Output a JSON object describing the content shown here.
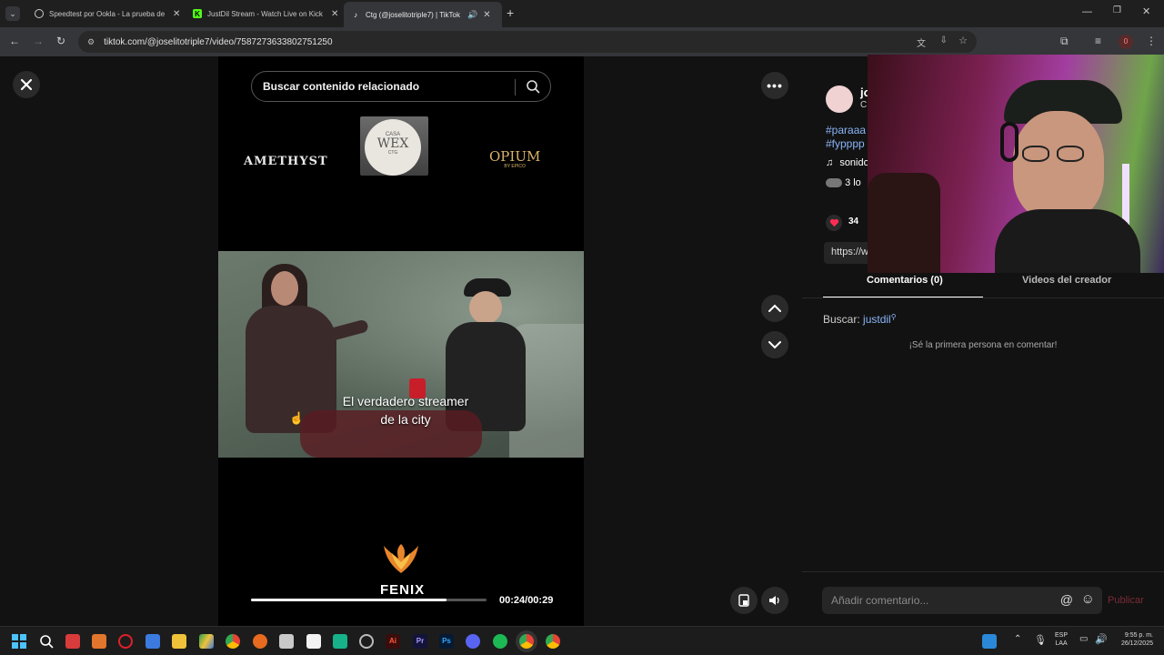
{
  "browser": {
    "tabs": [
      {
        "title": "Speedtest por Ookla - La prueba de",
        "active": false
      },
      {
        "title": "JustDil Stream - Watch Live on Kick",
        "active": false
      },
      {
        "title": "Ctg (@joselitotriple7) | TikTok",
        "active": true
      }
    ],
    "url": "tiktok.com/@joselitotriple7/video/7587273633802751250",
    "profile_initial": "0"
  },
  "video": {
    "search_placeholder": "Buscar contenido relacionado",
    "sponsor_logos": [
      "AMETHYST",
      "CASA",
      "WEX",
      "CTG",
      "OPIUM",
      "BY EPICO"
    ],
    "caption_line1": "El verdadero streamer",
    "caption_line2": "de la city",
    "brand": "FENIX",
    "time": "00:24/00:29",
    "progress": 0.83
  },
  "panel": {
    "author_initial": "jo",
    "author_sub": "C",
    "hashtags_line1": "#paraaa",
    "hashtags_line2": "#fypppp",
    "sound_prefix": "♫",
    "sound_label": "sonido",
    "likes_text": "3 lo",
    "like_count": "34",
    "link_text": "https://w",
    "tab_comments": "Comentarios (0)",
    "tab_videos": "Videos del creador",
    "search_prefix": "Buscar:",
    "search_term": "justdil",
    "empty_comments": "¡Sé la primera persona en comentar!",
    "comment_placeholder": "Añadir comentario...",
    "publish": "Publicar"
  },
  "taskbar": {
    "lang1": "ESP",
    "lang2": "LAA",
    "time": "9:55 p. m.",
    "date": "26/12/2025"
  },
  "colors": {
    "accent": "#fe2c55",
    "link": "#8ab4f8"
  }
}
